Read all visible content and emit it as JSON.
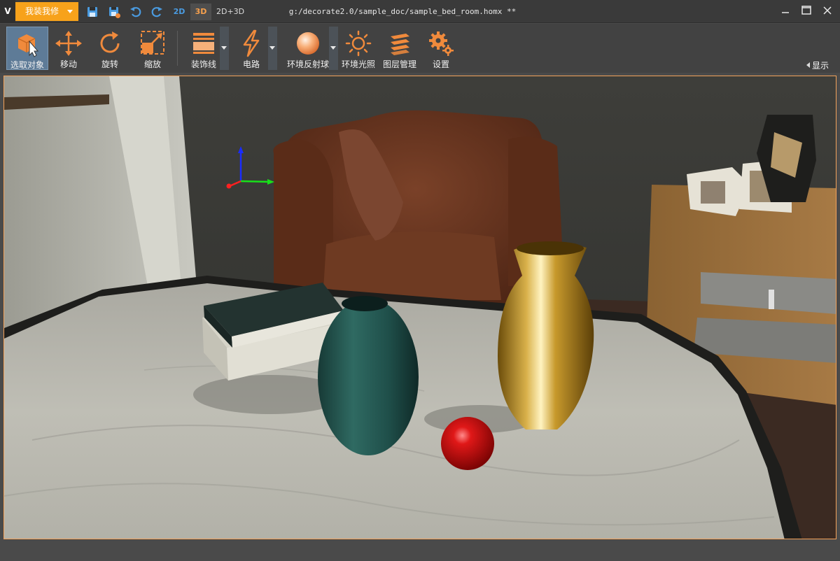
{
  "titlebar": {
    "logo": "V",
    "app_menu_label": "我装我修",
    "view_modes": [
      "2D",
      "3D",
      "2D+3D"
    ],
    "active_view": "3D",
    "document_title": "g:/decorate2.0/sample_doc/sample_bed_room.homx **",
    "quick_actions": [
      "save-icon",
      "save-as-icon",
      "undo-icon",
      "redo-icon"
    ],
    "window_controls": [
      "minimize-icon",
      "maximize-icon",
      "close-icon"
    ]
  },
  "toolbar": {
    "tools": [
      {
        "id": "select",
        "label": "选取对象",
        "icon": "select-object-icon",
        "active": true
      },
      {
        "id": "move",
        "label": "移动",
        "icon": "move-arrows-icon"
      },
      {
        "id": "rotate",
        "label": "旋转",
        "icon": "rotate-icon"
      },
      {
        "id": "scale",
        "label": "缩放",
        "icon": "scale-icon"
      },
      {
        "id": "molding",
        "label": "装饰线",
        "icon": "molding-icon",
        "dropdown": true
      },
      {
        "id": "circuit",
        "label": "电路",
        "icon": "lightning-icon",
        "dropdown": true
      },
      {
        "id": "env_probe",
        "label": "环境反射球",
        "icon": "reflection-sphere-icon",
        "dropdown": true
      },
      {
        "id": "env_light",
        "label": "环境光照",
        "icon": "sun-icon"
      },
      {
        "id": "layers",
        "label": "图层管理",
        "icon": "layers-icon"
      },
      {
        "id": "settings",
        "label": "设置",
        "icon": "gears-icon"
      }
    ],
    "show_toggle_label": "显示"
  },
  "colors": {
    "accent_orange": "#f7a21b",
    "tool_orange": "#f08a3c",
    "active_tool_bg": "#5e7b97",
    "viewport_border": "#f3a25a"
  },
  "scene": {
    "objects": [
      "wall-shelf",
      "leather-armchair",
      "throw-pillow",
      "marble-coffee-table",
      "book-stack",
      "green-ceramic-vase",
      "gold-vase",
      "red-sphere",
      "wooden-nightstand",
      "photo-frame-left",
      "photo-frame-right",
      "decor-cube-lamp",
      "xyz-gizmo"
    ]
  }
}
